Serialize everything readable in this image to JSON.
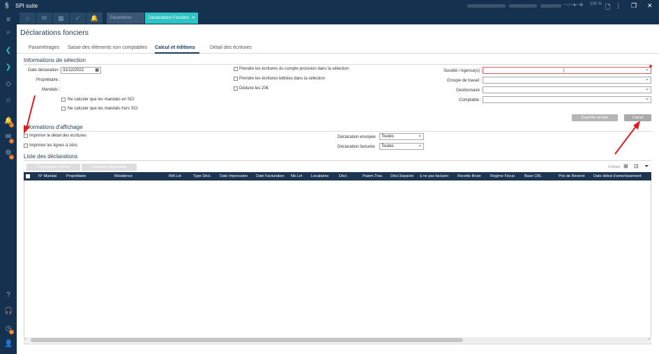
{
  "app": {
    "title": "SPI suite"
  },
  "window": {
    "zoom": "100 %",
    "controls": [
      "▫",
      "❐",
      "✕"
    ]
  },
  "tabs": [
    {
      "label": "Paramètres"
    },
    {
      "label": "Déclarations Fonciers",
      "close": "✕"
    }
  ],
  "page": {
    "title": "Déclarations fonciers"
  },
  "subtabs": [
    {
      "label": "Paramétrages"
    },
    {
      "label": "Saisie des éléments non comptables"
    },
    {
      "label": "Calcul et éditions"
    },
    {
      "label": "Détail des écritures"
    }
  ],
  "selection": {
    "section_title": "Informations de sélection",
    "date_label": "Date déclaration :",
    "date_value": "31/12/2022",
    "proprietaire_label": "Propriétaire :",
    "mandats_label": "Mandats :",
    "opt_sci": "Ne calculer que les mandats en SCI",
    "opt_hors_sci": "Ne calculer que les mandats hors SCI",
    "opt_provision": "Prendre les écritures du compte provision dans la sélection",
    "opt_lettrees": "Prendre les écritures lettrées dans la sélection",
    "opt_20": "Déduire les 20€",
    "societe_label": "Société / Agence(s) :",
    "groupe_label": "Groupe de travail :",
    "gestionnaire_label": "Gestionnaire :",
    "comptable_label": "Comptable :",
    "export_button": "Exporter la liste",
    "calcul_button": "Calcul"
  },
  "affichage": {
    "section_title": "Informations d'affichage",
    "opt_detail": "Imprimer le détail des écritures",
    "opt_zero": "Imprimer les lignes à zéro",
    "envoyee_label": "Déclaration envoyée",
    "envoyee_value": "Toutes",
    "facturee_label": "Déclaration facturée",
    "facturee_value": "Toutes"
  },
  "liste": {
    "section_title": "Liste des déclarations",
    "facturation_button": "Facturation Foncier",
    "imprimer_button": "Imprimer déclaration",
    "count": "0 fiches",
    "columns": [
      "N° Mandat",
      "Propriétaire",
      "Résidence",
      "Réf.Lot",
      "Type Décl.",
      "Date Impression",
      "Date Facturation",
      "Nb.Lot",
      "Locataires",
      "Décl.",
      "Paiem.Trav.",
      "Décl.Separée",
      "à ne pas facturer",
      "Recette Brute",
      "Regime Fiscal",
      "Base CRL",
      "Prix de Revient",
      "Date début d'amortissement"
    ]
  },
  "sidebar": {
    "badges": [
      "1",
      "4",
      "8",
      "10"
    ]
  }
}
